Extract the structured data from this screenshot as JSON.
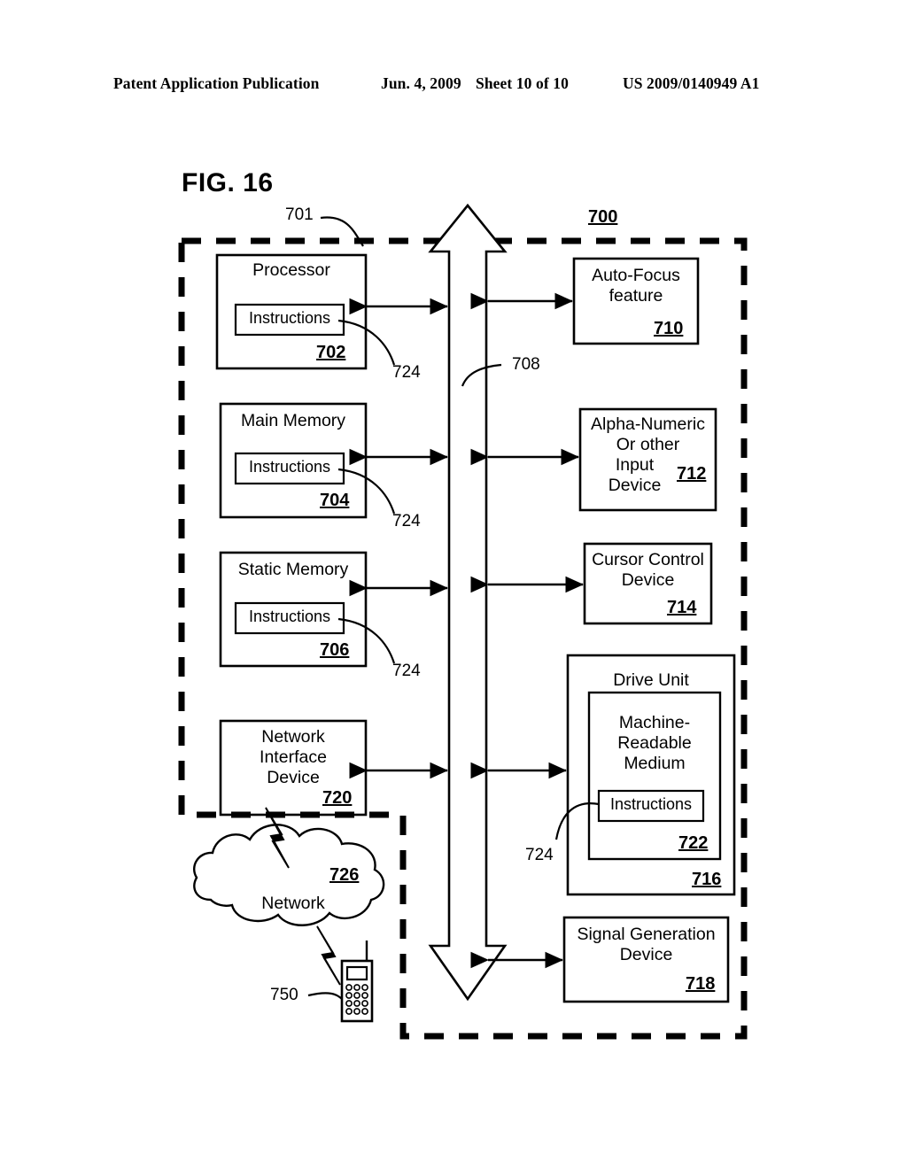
{
  "header": {
    "publication": "Patent Application Publication",
    "date": "Jun. 4, 2009",
    "sheet": "Sheet 10 of 10",
    "patent_number": "US 2009/0140949 A1"
  },
  "figure": {
    "title": "FIG. 16",
    "system_ref": "700",
    "boundary_ref": "701",
    "bus_ref": "708",
    "instructions_label": "Instructions",
    "blocks": {
      "processor": {
        "title": "Processor",
        "ref": "702",
        "inner": "Instructions",
        "leader": "724"
      },
      "main_memory": {
        "title": "Main Memory",
        "ref": "704",
        "inner": "Instructions",
        "leader": "724"
      },
      "static_memory": {
        "title": "Static Memory",
        "ref": "706",
        "inner": "Instructions",
        "leader": "724"
      },
      "network_iface": {
        "title_l1": "Network",
        "title_l2": "Interface",
        "title_l3": "Device",
        "ref": "720"
      },
      "auto_focus": {
        "title_l1": "Auto-Focus",
        "title_l2": "feature",
        "ref": "710"
      },
      "alpha_numeric": {
        "title_l1": "Alpha-Numeric",
        "title_l2": "Or other",
        "title_l3": "Input",
        "title_l4": "Device",
        "ref": "712"
      },
      "cursor_control": {
        "title_l1": "Cursor Control",
        "title_l2": "Device",
        "ref": "714"
      },
      "drive_unit": {
        "title": "Drive Unit",
        "ref": "716",
        "leader": "724"
      },
      "machine_medium": {
        "title_l1": "Machine-",
        "title_l2": "Readable",
        "title_l3": "Medium",
        "ref": "722",
        "inner": "Instructions"
      },
      "signal_gen": {
        "title_l1": "Signal Generation",
        "title_l2": "Device",
        "ref": "718"
      }
    },
    "network": {
      "label": "Network",
      "ref": "726",
      "device_ref": "750"
    }
  }
}
